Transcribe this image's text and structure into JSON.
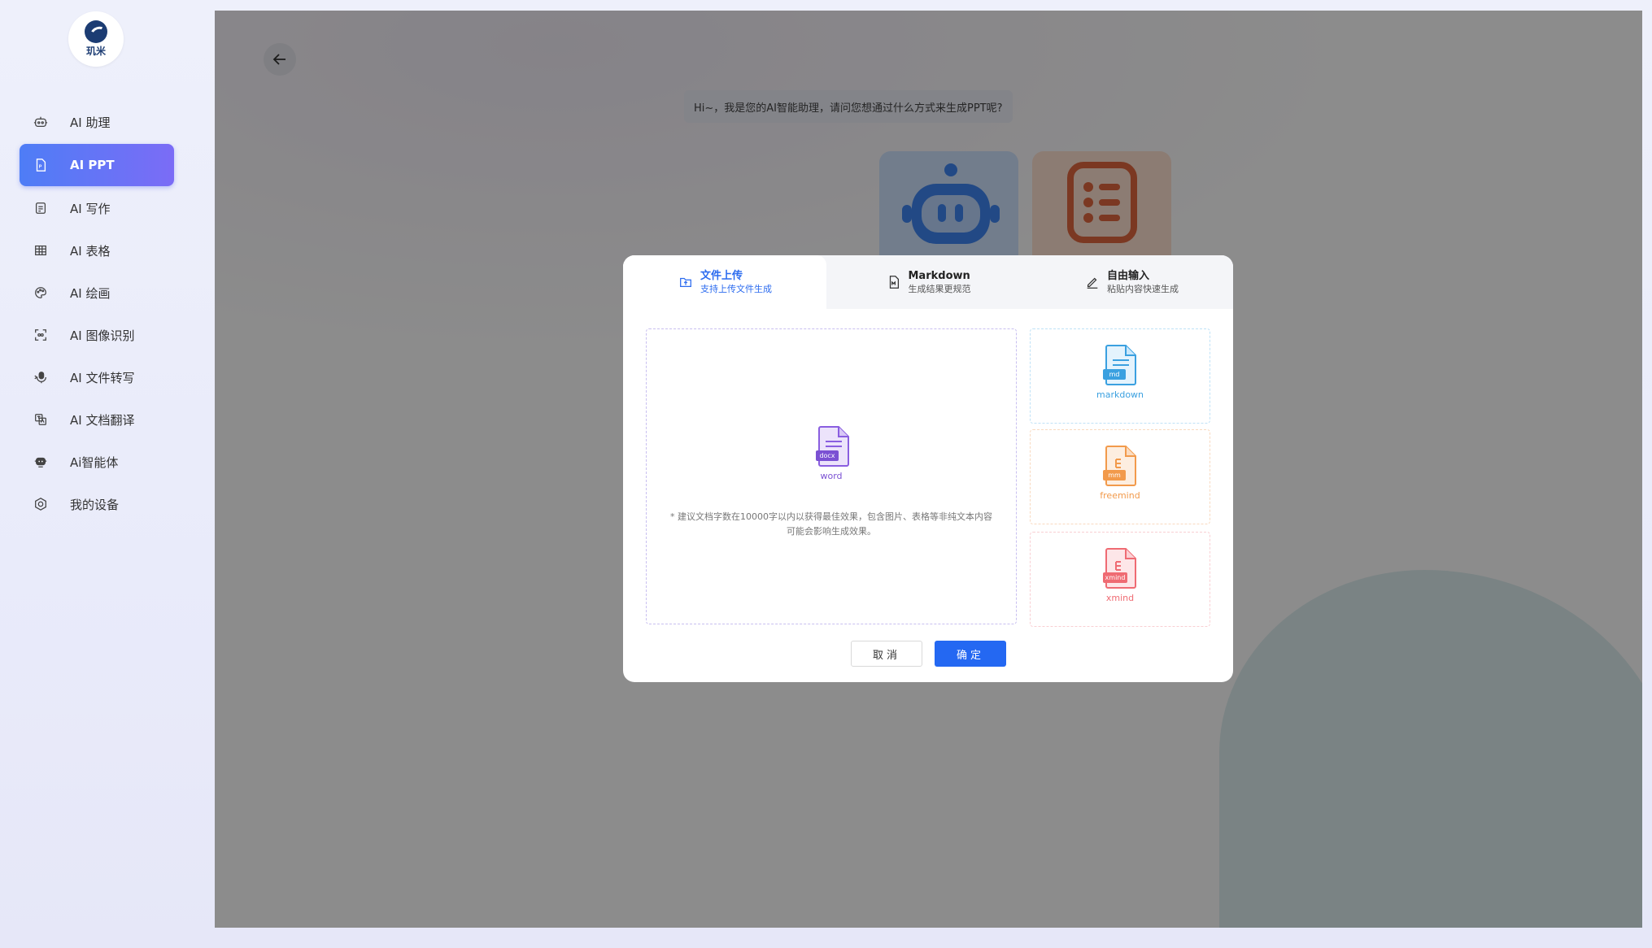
{
  "app": {
    "logo_text": "玑米"
  },
  "sidebar": {
    "items": [
      {
        "label": "AI 助理",
        "icon": "robot-icon"
      },
      {
        "label": "AI PPT",
        "icon": "ppt-icon",
        "active": true
      },
      {
        "label": "AI 写作",
        "icon": "document-icon"
      },
      {
        "label": "AI 表格",
        "icon": "table-icon"
      },
      {
        "label": "AI 绘画",
        "icon": "palette-icon"
      },
      {
        "label": "AI 图像识别",
        "icon": "scan-icon"
      },
      {
        "label": "AI 文件转写",
        "icon": "mic-icon"
      },
      {
        "label": "AI 文档翻译",
        "icon": "translate-icon"
      },
      {
        "label": "Ai智能体",
        "icon": "agent-icon"
      },
      {
        "label": "我的设备",
        "icon": "device-icon"
      }
    ]
  },
  "main": {
    "greeting": "Hi~，我是您的AI智能助理，请问您想通过什么方式来生成PPT呢?"
  },
  "modal": {
    "tabs": [
      {
        "title": "文件上传",
        "subtitle": "支持上传文件生成",
        "icon": "upload-file-icon",
        "active": true
      },
      {
        "title": "Markdown",
        "subtitle": "生成结果更规范",
        "icon": "markdown-file-icon"
      },
      {
        "title": "自由输入",
        "subtitle": "粘贴内容快速生成",
        "icon": "pencil-icon"
      }
    ],
    "upload": {
      "file_badge": "docx",
      "file_label": "word",
      "hint": "* 建议文档字数在10000字以内以获得最佳效果，包含图片、表格等非纯文本内容可能会影响生成效果。"
    },
    "options": [
      {
        "badge": "md",
        "label": "markdown"
      },
      {
        "badge": "mm",
        "label": "freemind"
      },
      {
        "badge": "xmind",
        "label": "xmind"
      }
    ],
    "cancel_label": "取消",
    "ok_label": "确定"
  },
  "colors": {
    "accent": "#2468f2",
    "nav_active_start": "#4e7df6",
    "nav_active_end": "#7b6cf6",
    "word": "#7b51d3",
    "markdown": "#3aa0e0",
    "freemind": "#f29a4b",
    "xmind": "#ef6b73"
  }
}
